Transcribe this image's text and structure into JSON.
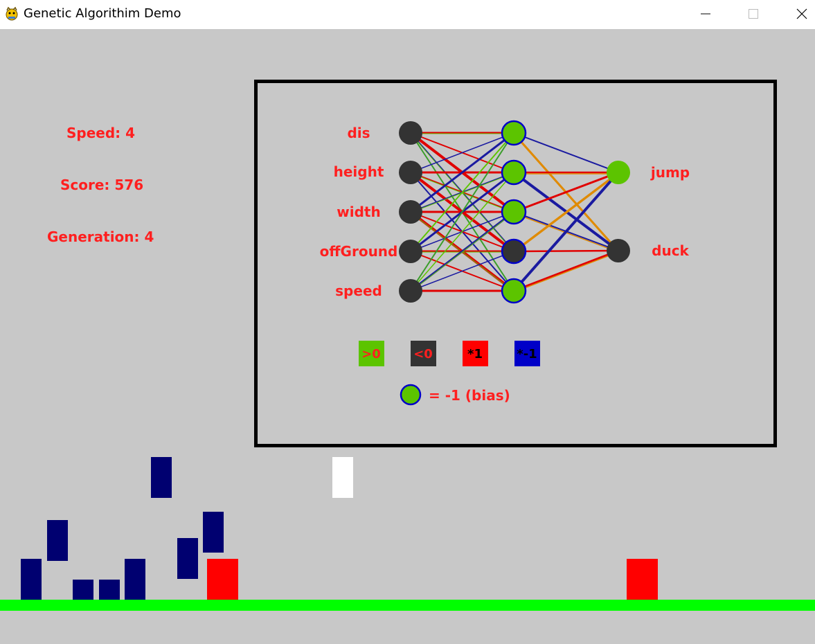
{
  "window": {
    "title": "Genetic Algorithim Demo"
  },
  "stats": {
    "speed": "Speed: 4",
    "score": "Score: 576",
    "generation": "Generation: 4"
  },
  "network": {
    "inputs": [
      "dis",
      "height",
      "width",
      "offGround",
      "speed"
    ],
    "outputs": [
      "jump",
      "duck"
    ],
    "legend": {
      "positive": ">0",
      "negative": "<0",
      "times_one": "*1",
      "times_neg_one": "*-1",
      "bias": "= -1 (bias)"
    }
  },
  "colors": {
    "background": "#c8c8c8",
    "stat_text": "#ff1f1f",
    "active_node": "#5cc400",
    "inactive_node": "#333333",
    "positive_weight": "#5cc400",
    "negative_weight": "#333333",
    "times_one": "#ff0000",
    "times_neg_one": "#0000c8",
    "ground": "#00ff00",
    "player": "#000070",
    "obstacle": "#ff0000",
    "bird": "#ffffff"
  }
}
